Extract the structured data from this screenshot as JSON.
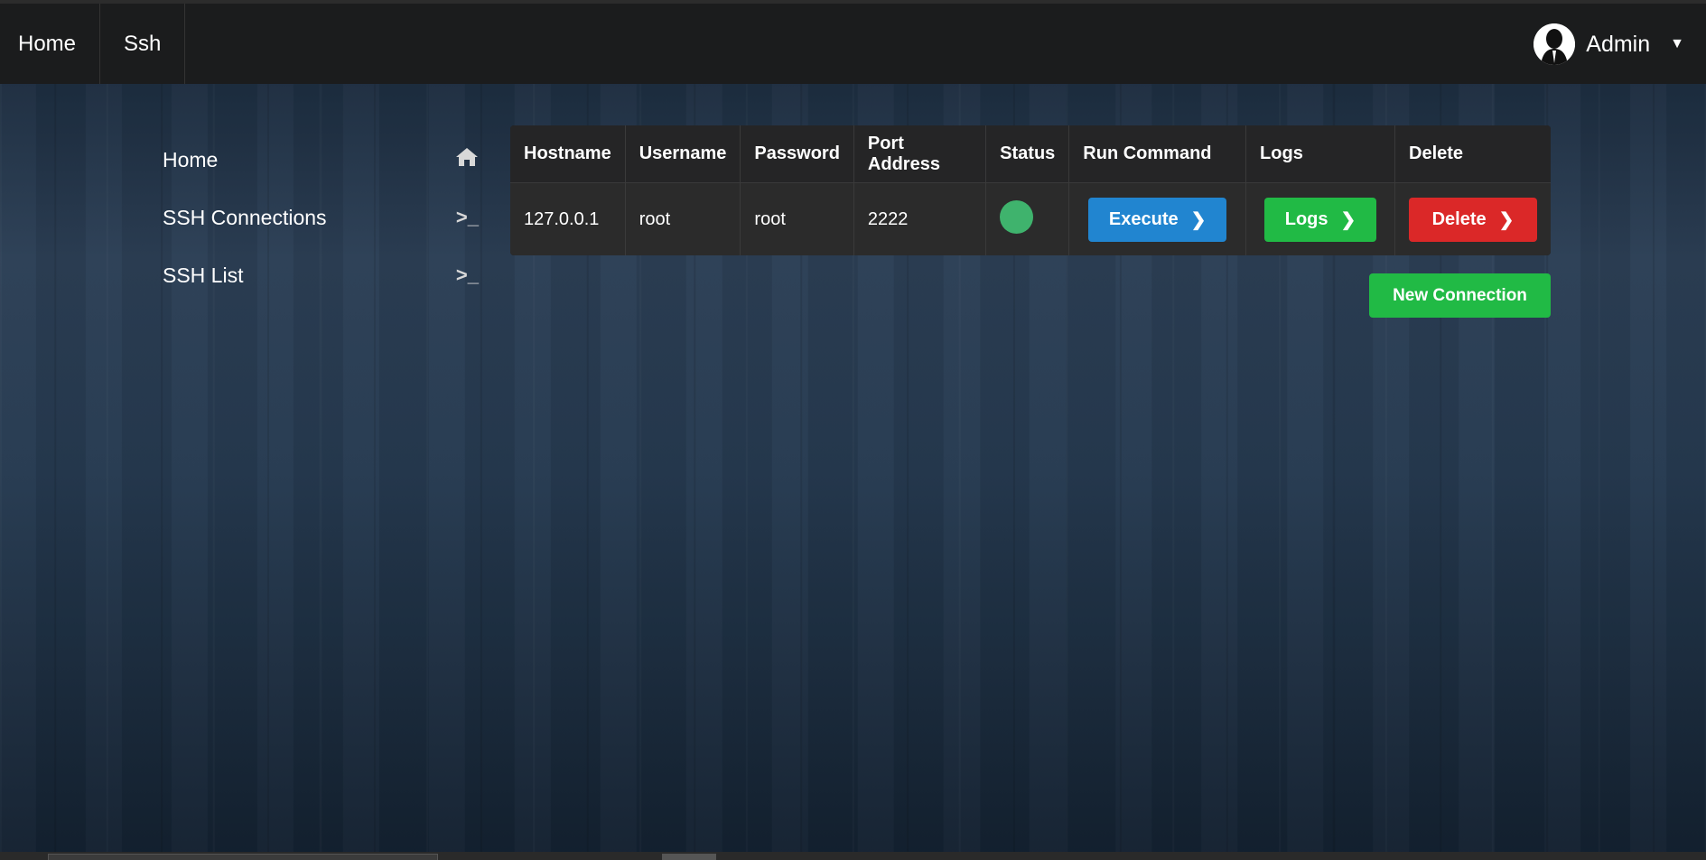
{
  "topnav": {
    "items": [
      "Home",
      "Ssh"
    ],
    "user": "Admin"
  },
  "sidebar": {
    "items": [
      {
        "label": "Home",
        "icon": "home-icon"
      },
      {
        "label": "SSH Connections",
        "icon": "terminal-icon"
      },
      {
        "label": "SSH List",
        "icon": "terminal-icon"
      }
    ]
  },
  "table": {
    "headers": [
      "Hostname",
      "Username",
      "Password",
      "Port Address",
      "Status",
      "Run Command",
      "Logs",
      "Delete"
    ],
    "rows": [
      {
        "hostname": "127.0.0.1",
        "username": "root",
        "password": "root",
        "port": "2222",
        "status": "online"
      }
    ],
    "buttons": {
      "execute": "Execute",
      "logs": "Logs",
      "delete": "Delete"
    }
  },
  "new_connection_label": "New Connection",
  "colors": {
    "execute": "#2185d0",
    "logs": "#21ba45",
    "delete": "#db2828",
    "status_online": "#3fb36d"
  }
}
